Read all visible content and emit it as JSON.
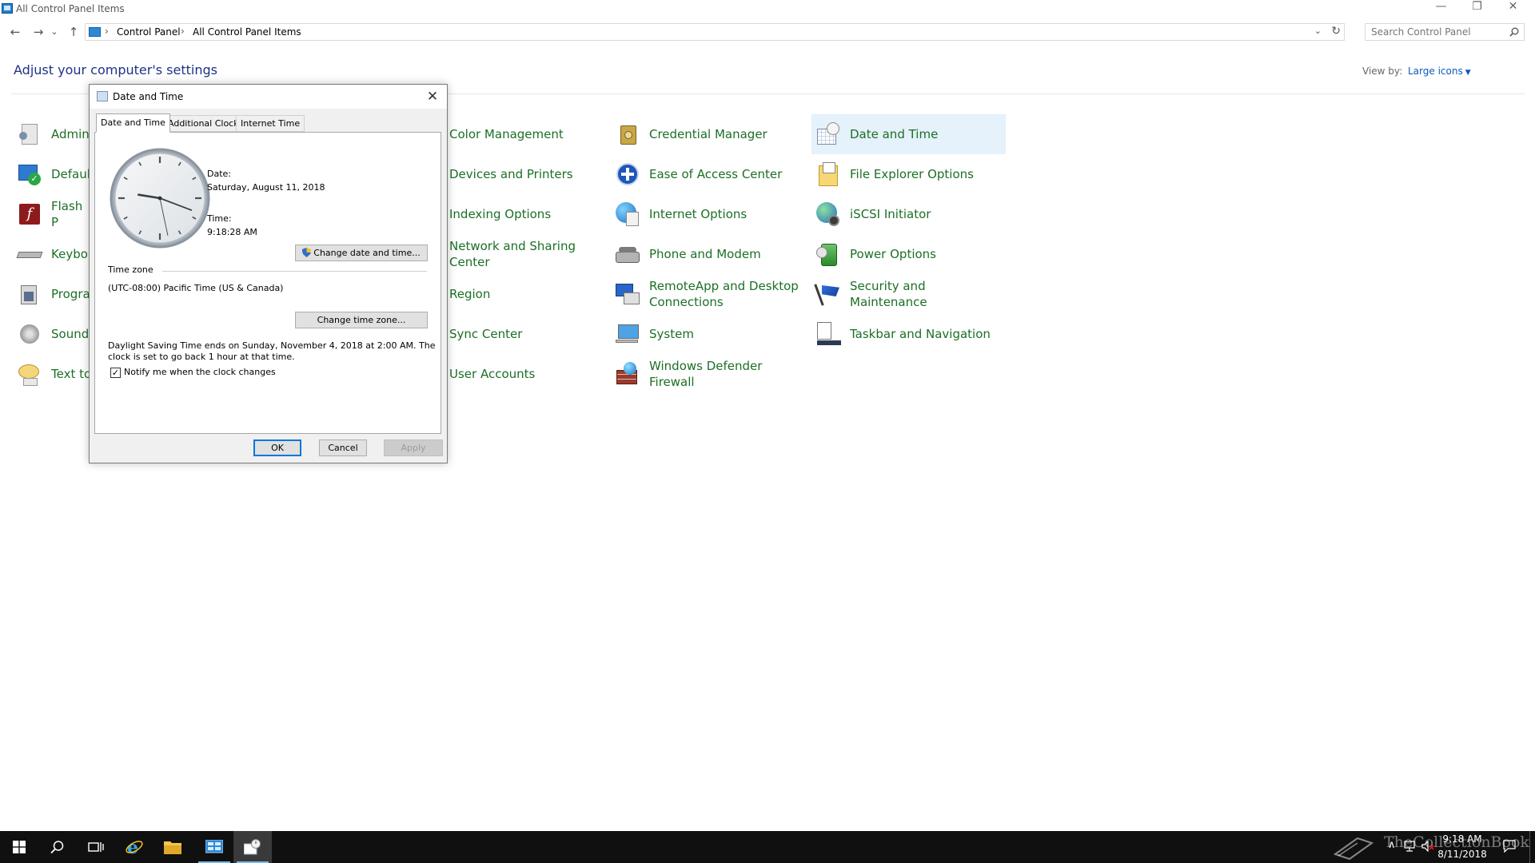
{
  "window": {
    "title": "All Control Panel Items",
    "minimize": "—",
    "restore": "❐",
    "close": "✕"
  },
  "nav": {
    "back": "←",
    "forward": "→",
    "recent": "⌄",
    "up": "↑"
  },
  "address": {
    "sep": "›",
    "crumbs": [
      "Control Panel",
      "All Control Panel Items"
    ],
    "dropdown": "⌄",
    "refresh": "↻"
  },
  "search": {
    "placeholder": "Search Control Panel"
  },
  "main": {
    "heading": "Adjust your computer's settings",
    "view_by_label": "View by:",
    "view_by_value": "Large icons"
  },
  "items": {
    "col1": [
      "Admini",
      "Default",
      "Flash P",
      "Keyboa",
      "Progra",
      "Sound",
      "Text to"
    ],
    "col2": [
      "Color Management",
      "Devices and Printers",
      "Indexing Options",
      "Network and Sharing Center",
      "Region",
      "Sync Center",
      "User Accounts"
    ],
    "col3": [
      "Credential Manager",
      "Ease of Access Center",
      "Internet Options",
      "Phone and Modem",
      "RemoteApp and Desktop Connections",
      "System",
      "Windows Defender Firewall"
    ],
    "col4": [
      "Date and Time",
      "File Explorer Options",
      "iSCSI Initiator",
      "Power Options",
      "Security and Maintenance",
      "Taskbar and Navigation"
    ]
  },
  "dialog": {
    "title": "Date and Time",
    "close": "✕",
    "tabs": [
      "Date and Time",
      "Additional Clocks",
      "Internet Time"
    ],
    "date_label": "Date:",
    "date_value": "Saturday, August 11, 2018",
    "time_label": "Time:",
    "time_value": "9:18:28 AM",
    "change_datetime": "Change date and time...",
    "timezone_label": "Time zone",
    "timezone_value": "(UTC-08:00) Pacific Time (US & Canada)",
    "change_timezone": "Change time zone...",
    "dst_line1": "Daylight Saving Time ends on Sunday, November 4, 2018 at 2:00 AM. The",
    "dst_line2": "clock is set to go back 1 hour at that time.",
    "notify_check": "✓",
    "notify_label": "Notify me when the clock changes",
    "ok": "OK",
    "cancel": "Cancel",
    "apply": "Apply"
  },
  "clock": {
    "hours": 9,
    "minutes": 18,
    "seconds": 28
  },
  "taskbar": {
    "time": "9:18 AM",
    "date": "8/11/2018",
    "watermark": "TheCollectionBook"
  }
}
